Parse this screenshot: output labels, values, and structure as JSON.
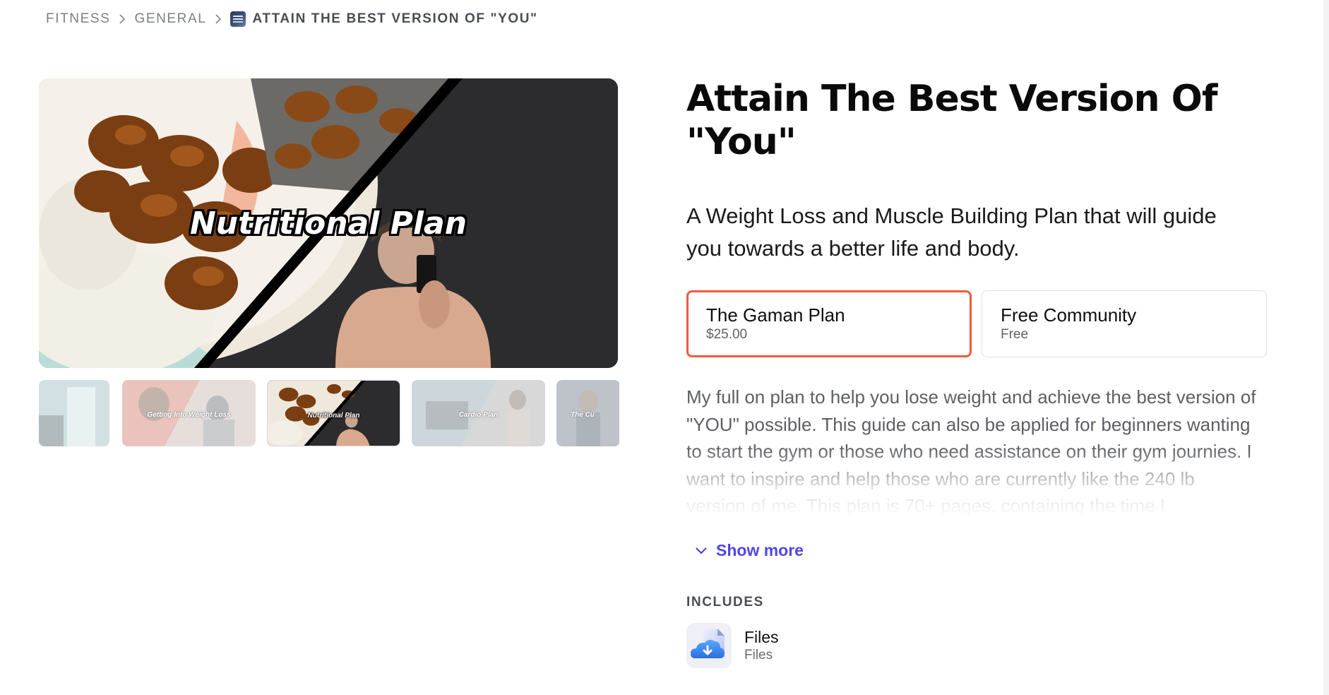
{
  "breadcrumb": {
    "items": [
      "FITNESS",
      "GENERAL"
    ],
    "current": "ATTAIN THE BEST VERSION OF \"YOU\""
  },
  "gallery": {
    "hero_caption": "Nutritional Plan",
    "thumbnails": [
      {
        "caption": ""
      },
      {
        "caption": "Getting Into Weight Loss"
      },
      {
        "caption": "Nutritional Plan"
      },
      {
        "caption": "Cardio Plan"
      },
      {
        "caption": "The Cu"
      }
    ]
  },
  "product": {
    "title": "Attain The Best Version Of \"You\"",
    "subtitle": "A Weight Loss and Muscle Building Plan that will guide you towards a better life and body.",
    "plans": [
      {
        "name": "The Gaman Plan",
        "price": "$25.00",
        "selected": true
      },
      {
        "name": "Free Community",
        "price": "Free",
        "selected": false
      }
    ],
    "description": "My full on plan to help you lose weight and achieve the best version of \"YOU\" possible. This guide can also be applied for beginners wanting to start the gym or those who need assistance on their gym journies. I want to inspire and help those who are currently like the 240 lb version of me. This plan is 70+ pages, containing the time I",
    "show_more": "Show more",
    "includes_label": "INCLUDES",
    "includes": [
      {
        "name": "Files",
        "sub": "Files",
        "icon": "cloud-download-file-icon"
      }
    ]
  },
  "colors": {
    "accent": "#ef5a3f",
    "link": "#4f46e5"
  }
}
